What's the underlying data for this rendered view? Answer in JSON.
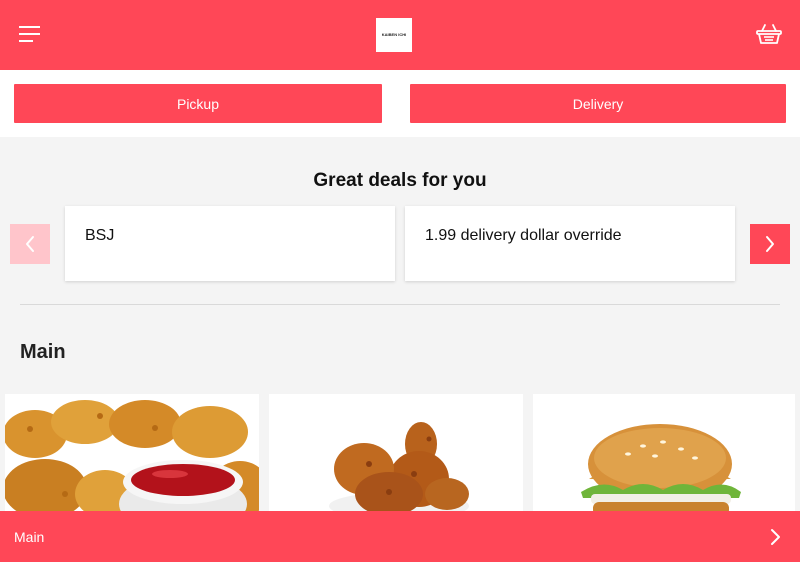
{
  "header": {
    "menu_icon": "hamburger-menu-icon",
    "logo_text": "KAIBEN ICHI",
    "cart_icon": "shopping-basket-icon",
    "background_color": "#ff4757"
  },
  "order_modes": {
    "pickup_label": "Pickup",
    "delivery_label": "Delivery"
  },
  "deals": {
    "title": "Great deals for you",
    "prev_icon": "chevron-left-icon",
    "next_icon": "chevron-right-icon",
    "items": [
      {
        "label": "BSJ"
      },
      {
        "label": "1.99 delivery dollar override"
      }
    ]
  },
  "menu_section": {
    "title": "Main",
    "products": [
      {
        "image": "chicken-nuggets-with-ketchup-image"
      },
      {
        "image": "fried-chicken-drumsticks-image"
      },
      {
        "image": "chicken-burger-image"
      }
    ]
  },
  "bottom_bar": {
    "label": "Main",
    "icon": "chevron-right-icon"
  },
  "colors": {
    "accent": "#ff4757",
    "accent_light": "#ffc5cb",
    "page_background": "#f4f4f4"
  }
}
